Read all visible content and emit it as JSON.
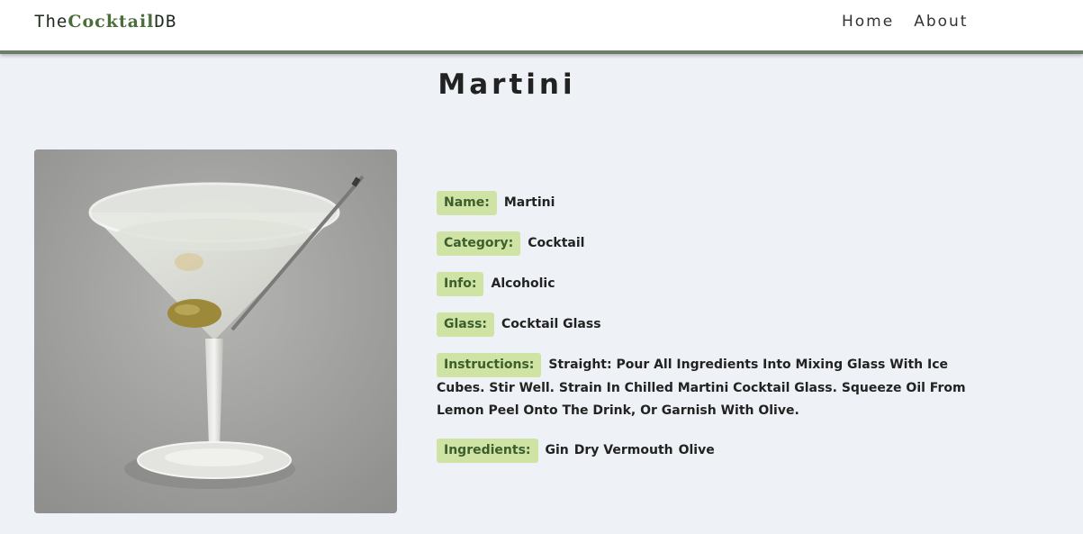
{
  "navbar": {
    "logo_prefix": "The",
    "logo_brand": "Cocktail",
    "logo_suffix": "DB",
    "links": [
      "Home",
      "About"
    ]
  },
  "page_title": "Martini",
  "image": {
    "icon": "martini-glass-photo"
  },
  "details": {
    "name_label": "Name:",
    "name": "Martini",
    "category_label": "Category:",
    "category": "Cocktail",
    "info_label": "Info:",
    "info": "Alcoholic",
    "glass_label": "Glass:",
    "glass": "Cocktail Glass",
    "instructions_label": "Instructions:",
    "instructions": "Straight: Pour All Ingredients Into Mixing Glass With Ice Cubes. Stir Well. Strain In Chilled Martini Cocktail Glass. Squeeze Oil From Lemon Peel Onto The Drink, Or Garnish With Olive.",
    "ingredients_label": "Ingredients:",
    "ingredients": [
      "Gin",
      "Dry Vermouth",
      "Olive"
    ]
  },
  "colors": {
    "background": "#eef2f6",
    "label_bg": "#cfe3a4",
    "label_text": "#3c5e2c",
    "brand": "#4a6d3a"
  }
}
